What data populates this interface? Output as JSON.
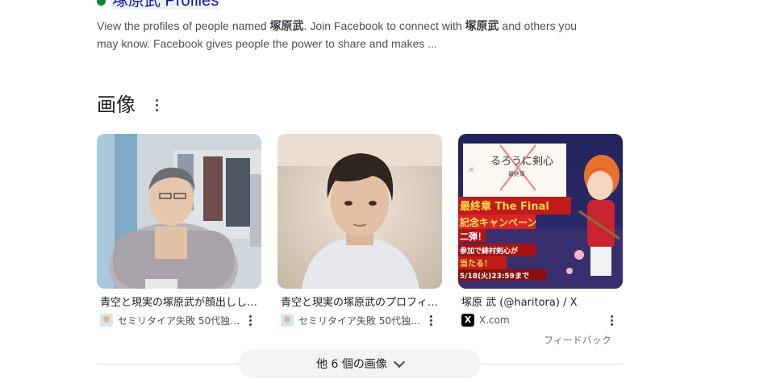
{
  "result": {
    "title": "塚原武 Profiles",
    "snippet_parts": [
      "View the profiles of people named ",
      "塚原武",
      ". Join Facebook to connect with ",
      "塚原武",
      " and others you may know. Facebook gives people the power to share and makes ..."
    ]
  },
  "images_section": {
    "title": "画像",
    "cards": [
      {
        "caption": "青空と現実の塚原武が顔出しした…",
        "source": "セミリタイア失敗 50代独身…",
        "favicon": "blog-favicon-icon"
      },
      {
        "caption": "青空と現実の塚原武のプロフィール…",
        "source": "セミリタイア失敗 50代独身…",
        "favicon": "blog-favicon-icon"
      },
      {
        "caption": "塚原 武 (@haritora) / X",
        "source": "X.com",
        "favicon": "x-favicon-icon",
        "favicon_text": "X"
      }
    ],
    "promo": {
      "title": "るろうに剣心",
      "sub": "最終章",
      "line1": "最終章 The Final",
      "line2": "記念キャンペーン",
      "line3": "二弾！",
      "line4": "参加で緋村剣心が",
      "line5": "当たる！",
      "date": "5/18(火)23:59まで"
    },
    "feedback": "フィードバック",
    "more_button": "他 6 個の画像"
  },
  "colors": {
    "link": "#1a0dab",
    "snippet": "#4d5156",
    "button_bg": "#f1f3f4"
  }
}
